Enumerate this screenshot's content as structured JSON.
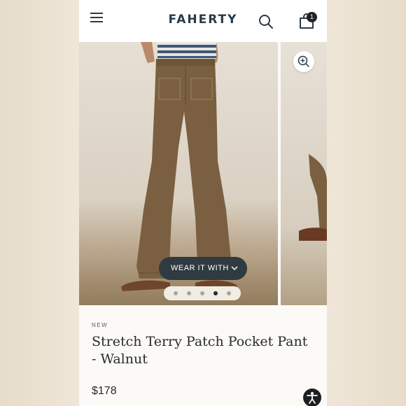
{
  "header": {
    "logo": "FAHERTY",
    "cart_count": "1"
  },
  "gallery": {
    "wear_it_with_label": "WEAR IT WITH",
    "slide_count": 5,
    "active_slide": 4
  },
  "product": {
    "badge": "NEW",
    "title": "Stretch Terry Patch Pocket Pant - Walnut",
    "price": "$178"
  },
  "icons": {
    "menu": "hamburger-menu-icon",
    "search": "search-icon",
    "bag": "shopping-bag-icon",
    "zoom": "zoom-in-icon",
    "chevron": "chevron-down-icon",
    "accessibility": "accessibility-icon"
  },
  "colors": {
    "brand_text": "#2a3a48",
    "dark_button": "#2f3a41",
    "pant_color": "#7a6040"
  }
}
